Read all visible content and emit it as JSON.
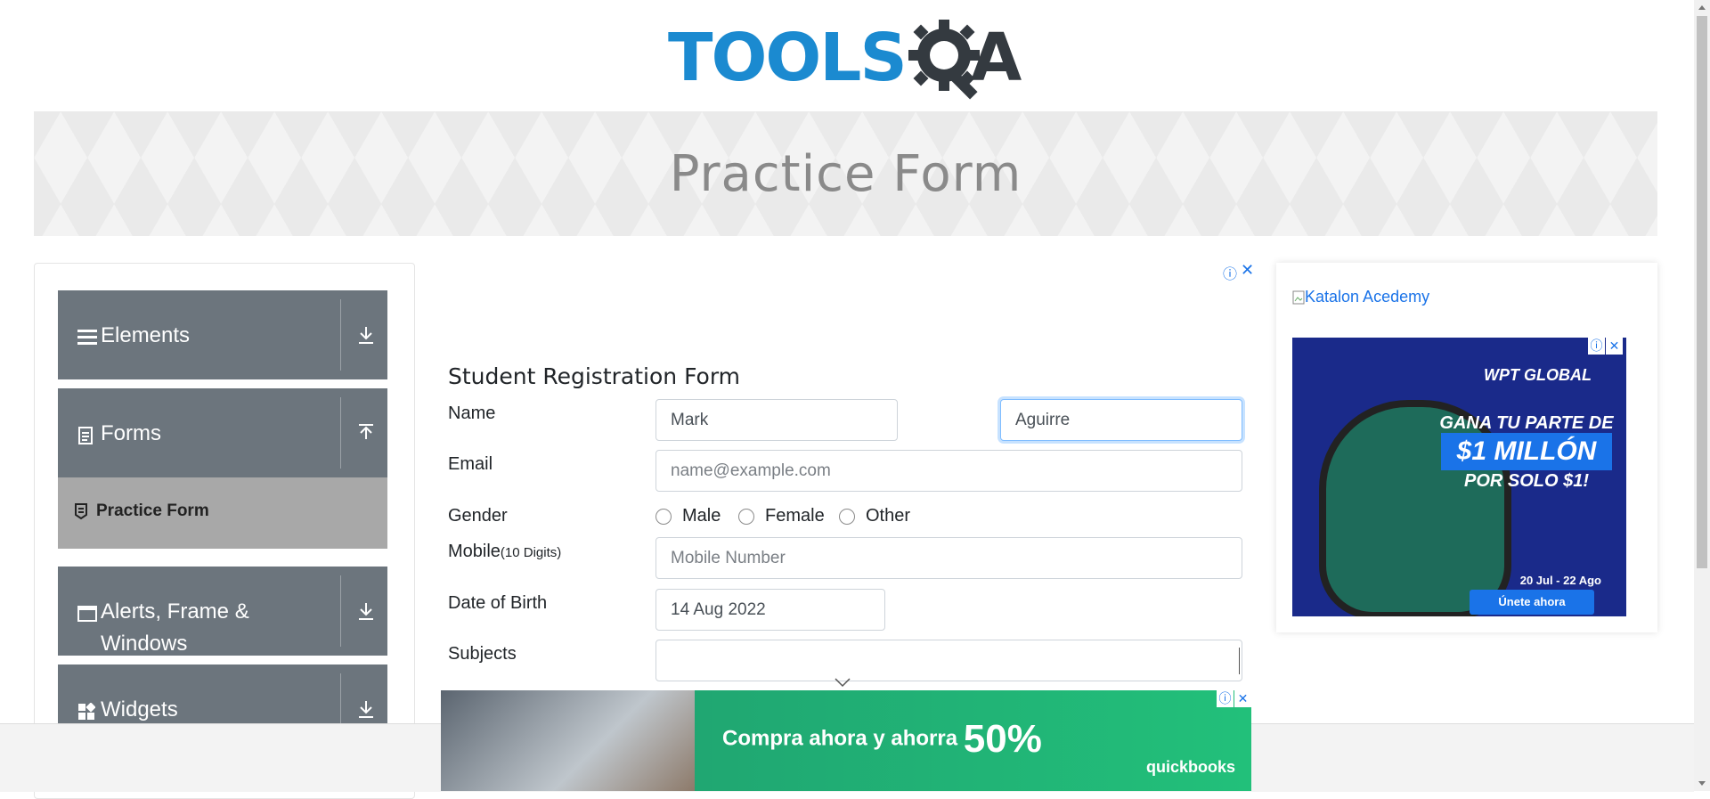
{
  "logo": {
    "word": "TOOLS",
    "letter": "A"
  },
  "banner": {
    "title": "Practice Form"
  },
  "sidebar": {
    "groups": [
      {
        "label": "Elements",
        "icon": "hamburger-icon"
      },
      {
        "label": "Forms",
        "icon": "document-icon",
        "expanded": true
      },
      {
        "label": "Alerts, Frame & Windows",
        "icon": "window-icon"
      },
      {
        "label": "Widgets",
        "icon": "widgets-icon"
      }
    ],
    "active_item": "Practice Form"
  },
  "form": {
    "title": "Student Registration Form",
    "name_label": "Name",
    "first_name": "Mark",
    "last_name": "Aguirre",
    "email_label": "Email",
    "email_placeholder": "name@example.com",
    "gender_label": "Gender",
    "genders": [
      "Male",
      "Female",
      "Other"
    ],
    "mobile_label": "Mobile",
    "mobile_hint": "(10 Digits)",
    "mobile_placeholder": "Mobile Number",
    "dob_label": "Date of Birth",
    "dob_value": "14 Aug 2022",
    "subjects_label": "Subjects",
    "subjects_value": ""
  },
  "right_ad": {
    "link_text": "Katalon Acedemy",
    "brand": "WPT GLOBAL",
    "line1": "GANA TU PARTE DE",
    "line2": "$1 MILLÓN",
    "line3": "POR SOLO $1!",
    "dates": "20 Jul - 22 Ago",
    "cta": "Únete ahora"
  },
  "bottom_ad": {
    "text": "Compra ahora y ahorra",
    "percent": "50%",
    "brand": "quickbooks"
  },
  "colors": {
    "menu_bg": "#6c757d",
    "active_item_bg": "#a8a8a8",
    "logo_blue": "#1b8ad0",
    "logo_dark": "#343a40",
    "ad_green": "#22c07a",
    "focus_border": "#80bdff"
  }
}
